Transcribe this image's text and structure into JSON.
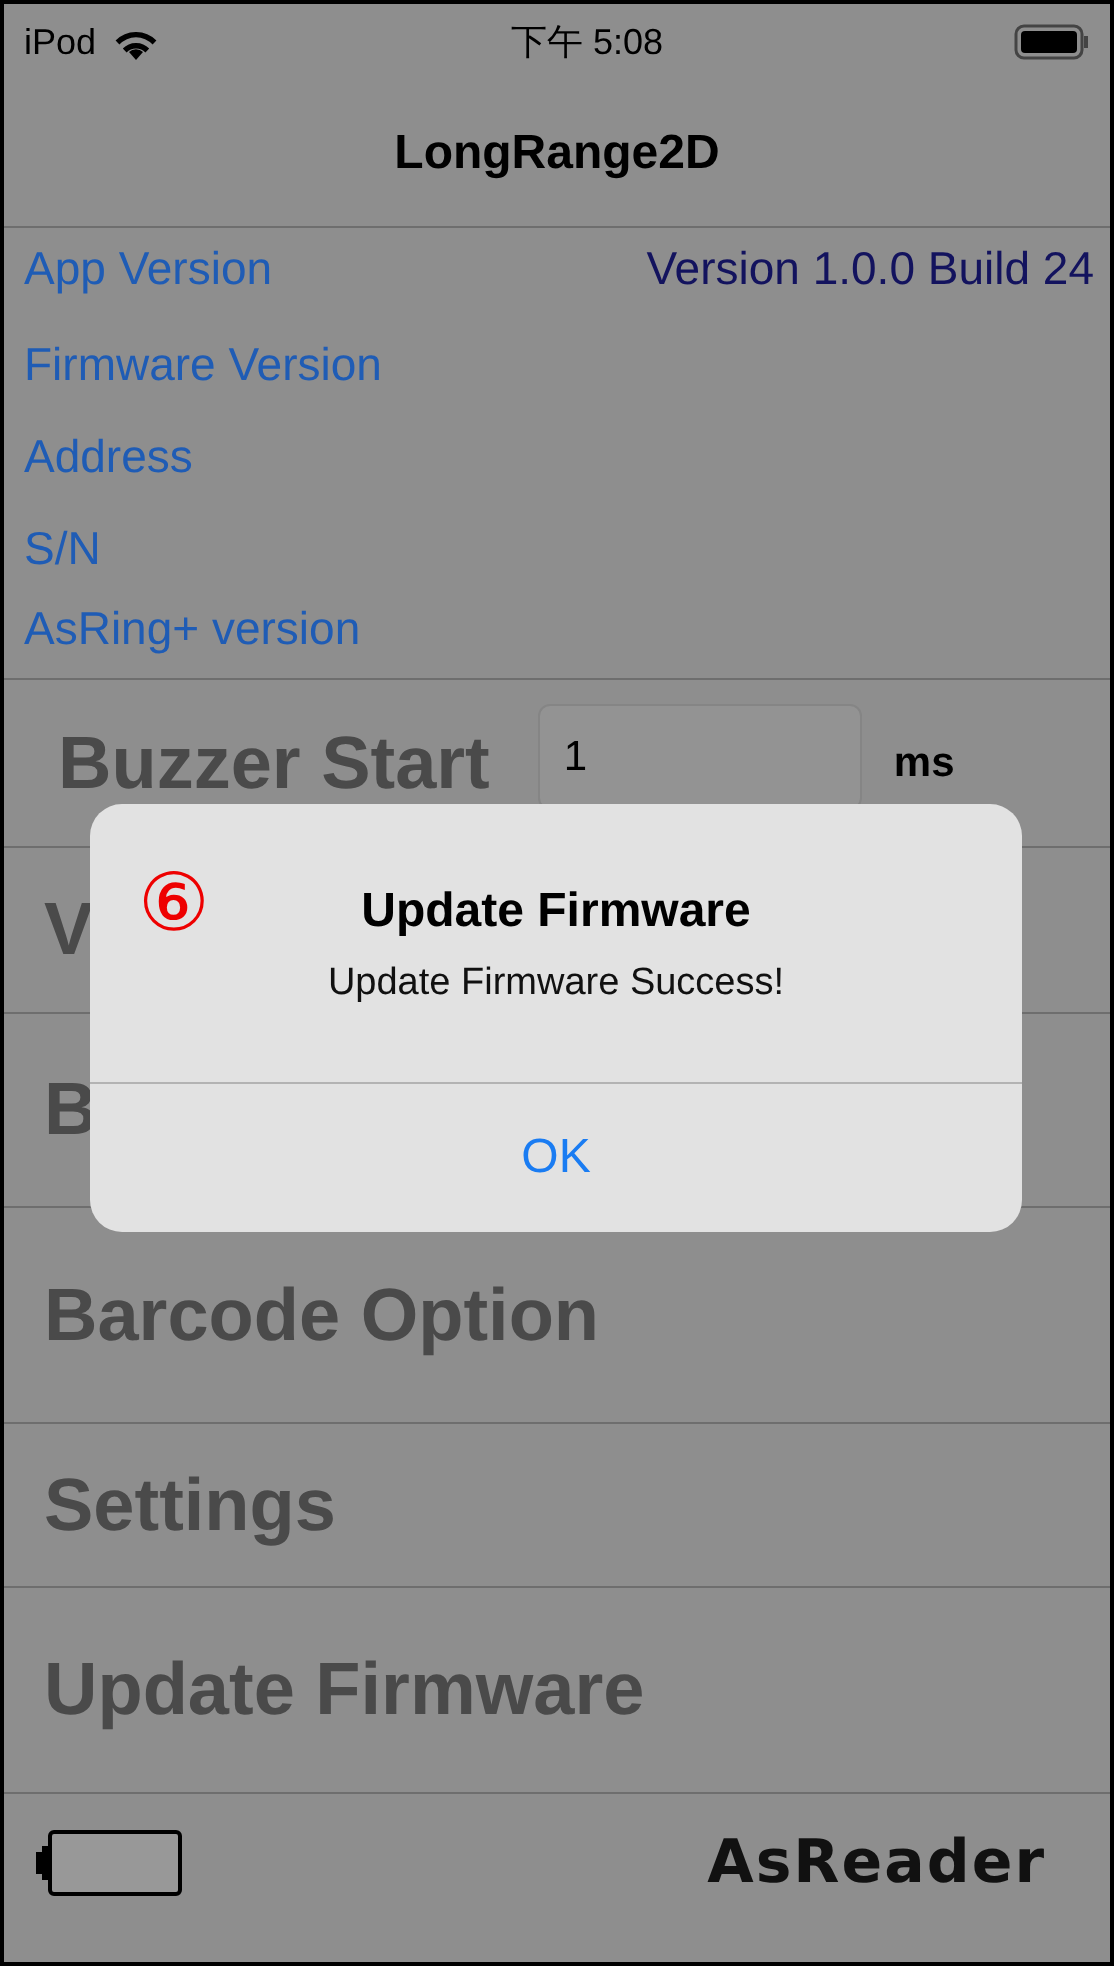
{
  "status_bar": {
    "device": "iPod",
    "time": "下午 5:08"
  },
  "nav": {
    "title": "LongRange2D"
  },
  "info": [
    {
      "label": "App Version",
      "value": "Version 1.0.0 Build 24"
    },
    {
      "label": "Firmware Version"
    },
    {
      "label": "Address"
    },
    {
      "label": "S/N"
    },
    {
      "label": "AsRing+ version"
    }
  ],
  "buzzer": {
    "label": "Buzzer Start",
    "value": "1",
    "unit": "ms"
  },
  "menu": [
    {
      "label": "V"
    },
    {
      "label": "B"
    },
    {
      "label": "Barcode Option"
    },
    {
      "label": "Settings"
    },
    {
      "label": "Update Firmware"
    }
  ],
  "footer": {
    "logo": "AsReader"
  },
  "alert": {
    "marker": "⑥",
    "title": "Update Firmware",
    "message": "Update Firmware Success!",
    "buttons": [
      "OK"
    ]
  }
}
